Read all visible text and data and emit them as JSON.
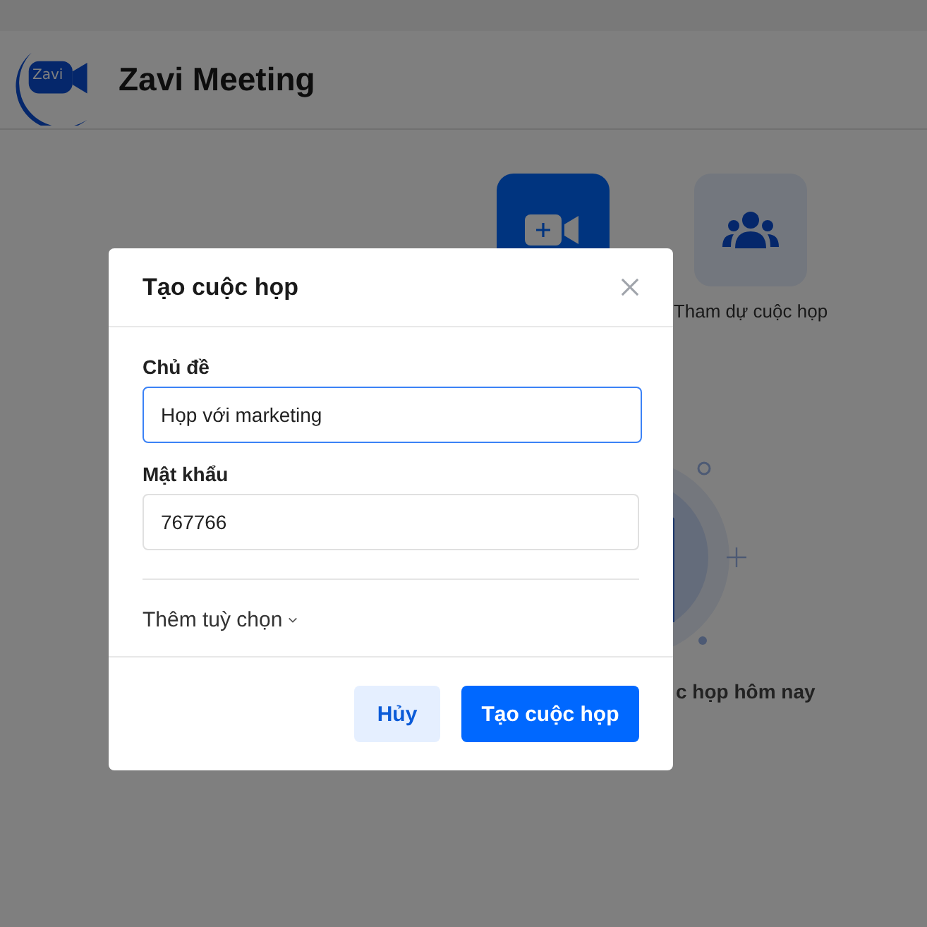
{
  "app": {
    "logo_text": "Zavi",
    "title": "Zavi Meeting"
  },
  "actions": [
    {
      "kind": "new"
    },
    {
      "kind": "join",
      "label": "Tham dự cuộc họp"
    }
  ],
  "today": {
    "label": "c họp hôm nay"
  },
  "dialog": {
    "title": "Tạo cuộc họp",
    "fields": [
      {
        "label": "Chủ đề",
        "value": "Họp với marketing",
        "focused": true
      },
      {
        "label": "Mật khẩu",
        "value": "767766",
        "focused": false
      }
    ],
    "more_options": "Thêm tuỳ chọn",
    "buttons": [
      {
        "label": "Hủy",
        "kind": "secondary"
      },
      {
        "label": "Tạo cuộc họp",
        "kind": "primary"
      }
    ]
  }
}
